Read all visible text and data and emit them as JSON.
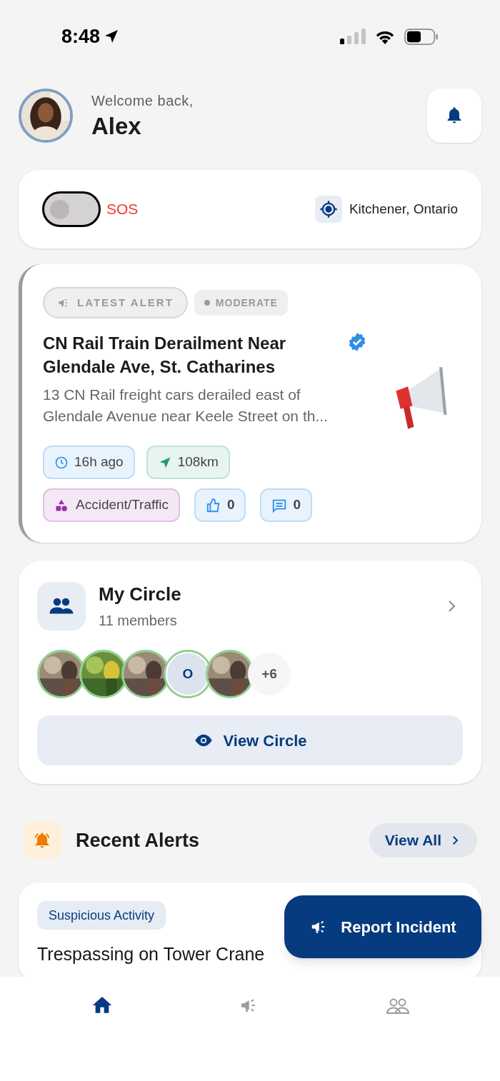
{
  "status_bar": {
    "time": "8:48"
  },
  "header": {
    "greeting": "Welcome back,",
    "name": "Alex"
  },
  "sos": {
    "label": "SOS",
    "on": false,
    "location": "Kitchener, Ontario"
  },
  "latest_alert": {
    "badge": "LATEST ALERT",
    "severity": "MODERATE",
    "title": "CN Rail Train Derailment Near Glendale Ave, St. Catharines",
    "verified": true,
    "description": "13 CN Rail freight cars derailed east of Glendale Avenue near Keele Street on th...",
    "time": "16h ago",
    "distance": "108km",
    "category": "Accident/Traffic",
    "likes": "0",
    "comments": "0"
  },
  "circle": {
    "title": "My Circle",
    "members_count": "11 members",
    "members": [
      {
        "kind": "picture"
      },
      {
        "kind": "picture"
      },
      {
        "kind": "picture"
      },
      {
        "kind": "initial",
        "initial": "O"
      },
      {
        "kind": "picture"
      }
    ],
    "more": "+6",
    "button": "View Circle"
  },
  "recent_alerts": {
    "title": "Recent Alerts",
    "view_all": "View All",
    "items": [
      {
        "category": "Suspicious Activity",
        "title": "Trespassing on Tower Crane"
      }
    ]
  },
  "report_button": "Report Incident",
  "tab_bar": [
    {
      "kind": "home",
      "selected": true
    },
    {
      "kind": "alerts",
      "selected": false
    },
    {
      "kind": "circle",
      "selected": false
    }
  ]
}
